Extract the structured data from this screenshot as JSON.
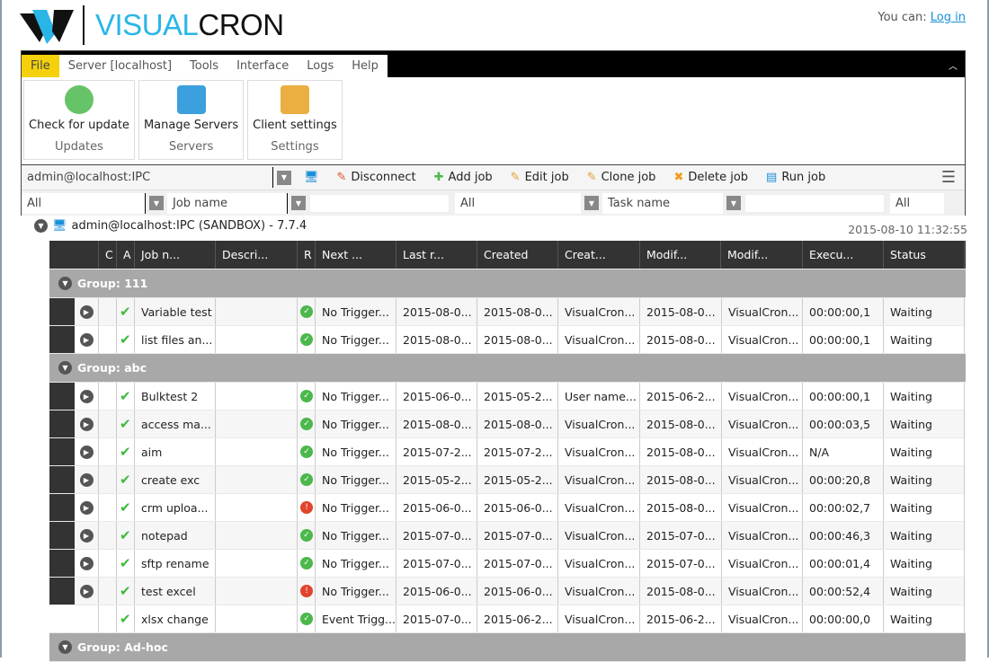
{
  "brand": {
    "name_part1": "VISUAL",
    "name_part2": "CRON",
    "accent": "#29b6e6"
  },
  "login": {
    "prefix": "You can:",
    "link": "Log in"
  },
  "menu": [
    "File",
    "Server [localhost]",
    "Tools",
    "Interface",
    "Logs",
    "Help"
  ],
  "ribbon": [
    {
      "label": "Check for update",
      "group": "Updates",
      "icon": "globe-download-icon"
    },
    {
      "label": "Manage Servers",
      "group": "Servers",
      "icon": "computers-icon"
    },
    {
      "label": "Client settings",
      "group": "Settings",
      "icon": "folder-gear-icon"
    }
  ],
  "toolbar": {
    "connection": "admin@localhost:IPC",
    "disconnect": "Disconnect",
    "add": "Add job",
    "edit": "Edit job",
    "clone": "Clone job",
    "delete": "Delete job",
    "run": "Run job"
  },
  "filters": {
    "f1": "All",
    "f2": "Job name",
    "f3": "",
    "f4": "All",
    "f5": "Task name",
    "f6": "",
    "f7": "All"
  },
  "server": {
    "label": "admin@localhost:IPC (SANDBOX) - 7.7.4",
    "timestamp": "2015-08-10 11:32:55"
  },
  "columns": [
    "C",
    "A",
    "Job n...",
    "Descri...",
    "R",
    "Next ...",
    "Last r...",
    "Created",
    "Creat...",
    "Modif...",
    "Modif...",
    "Execu...",
    "Status"
  ],
  "groups": [
    {
      "name": "Group: 111",
      "rows": [
        [
          "Variable test",
          "",
          "ok",
          "No Trigger...",
          "2015-08-0...",
          "2015-08-0...",
          "VisualCron...",
          "2015-08-0...",
          "VisualCron...",
          "00:00:00,1",
          "Waiting"
        ],
        [
          "list files an...",
          "",
          "ok",
          "No Trigger...",
          "2015-08-0...",
          "2015-08-0...",
          "VisualCron...",
          "2015-08-0...",
          "VisualCron...",
          "00:00:00,1",
          "Waiting"
        ]
      ]
    },
    {
      "name": "Group: abc",
      "rows": [
        [
          "Bulktest 2",
          "",
          "ok",
          "No Trigger...",
          "2015-06-0...",
          "2015-05-2...",
          "User name...",
          "2015-06-2...",
          "VisualCron...",
          "00:00:00,1",
          "Waiting"
        ],
        [
          "access ma...",
          "",
          "ok",
          "No Trigger...",
          "2015-08-0...",
          "2015-08-0...",
          "VisualCron...",
          "2015-08-0...",
          "VisualCron...",
          "00:00:03,5",
          "Waiting"
        ],
        [
          "aim",
          "",
          "ok",
          "No Trigger...",
          "2015-07-2...",
          "2015-07-2...",
          "VisualCron...",
          "2015-08-0...",
          "VisualCron...",
          "N/A",
          "Waiting"
        ],
        [
          "create exc",
          "",
          "ok",
          "No Trigger...",
          "2015-05-2...",
          "2015-05-2...",
          "VisualCron...",
          "2015-08-0...",
          "VisualCron...",
          "00:00:20,8",
          "Waiting"
        ],
        [
          "crm uploa...",
          "",
          "error",
          "No Trigger...",
          "2015-06-0...",
          "2015-06-0...",
          "VisualCron...",
          "2015-08-0...",
          "VisualCron...",
          "00:00:02,7",
          "Waiting"
        ],
        [
          "notepad",
          "",
          "ok",
          "No Trigger...",
          "2015-07-0...",
          "2015-07-0...",
          "VisualCron...",
          "2015-07-0...",
          "VisualCron...",
          "00:00:46,3",
          "Waiting"
        ],
        [
          "sftp rename",
          "",
          "ok",
          "No Trigger...",
          "2015-07-0...",
          "2015-07-0...",
          "VisualCron...",
          "2015-07-0...",
          "VisualCron...",
          "00:00:01,4",
          "Waiting"
        ],
        [
          "test excel",
          "",
          "error",
          "No Trigger...",
          "2015-06-0...",
          "2015-06-0...",
          "VisualCron...",
          "2015-08-0...",
          "VisualCron...",
          "00:00:52,4",
          "Waiting"
        ],
        [
          "xlsx change",
          "",
          "ok",
          "Event Trigg...",
          "2015-07-0...",
          "2015-06-2...",
          "VisualCron...",
          "2015-06-2...",
          "VisualCron...",
          "00:00:00,0",
          "Waiting"
        ]
      ]
    },
    {
      "name": "Group: Ad-hoc",
      "rows": []
    }
  ]
}
